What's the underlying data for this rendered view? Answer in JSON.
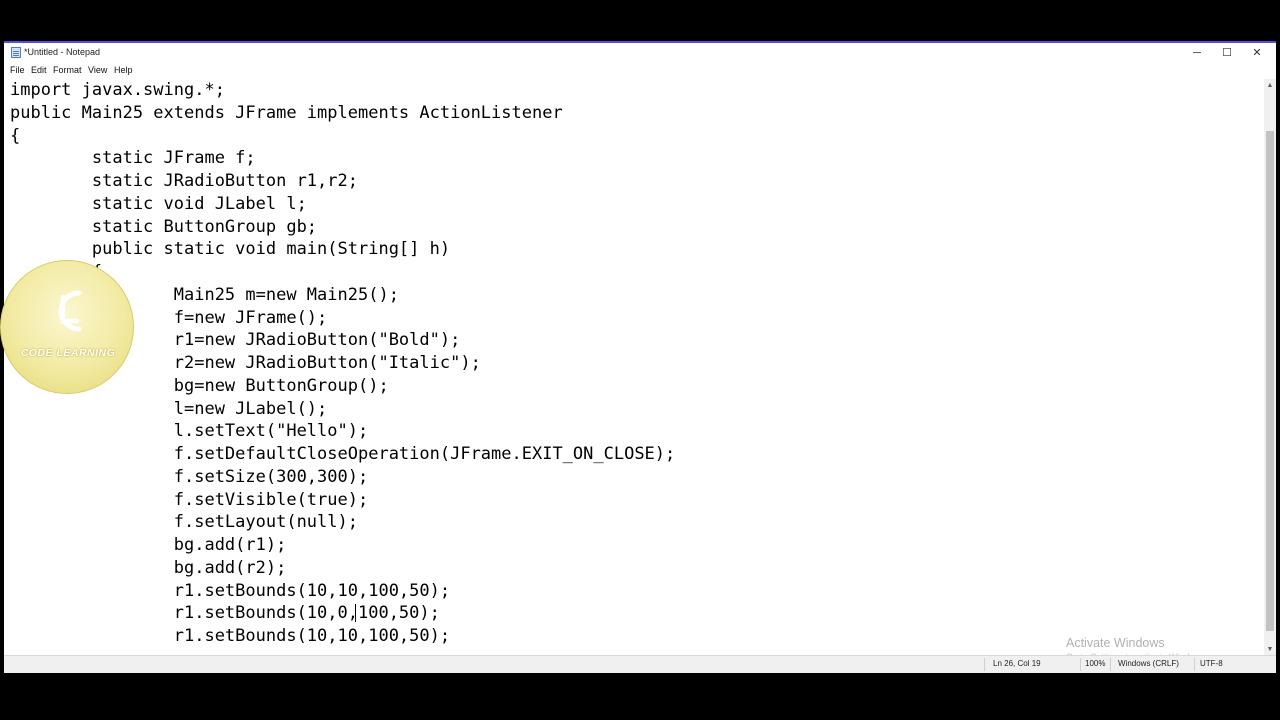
{
  "window": {
    "title": "*Untitled - Notepad",
    "minimize_glyph": "─",
    "maximize_glyph": "☐",
    "close_glyph": "✕",
    "accent": "#5b4ed6"
  },
  "menu": {
    "items": [
      {
        "label": "File"
      },
      {
        "label": "Edit"
      },
      {
        "label": "Format"
      },
      {
        "label": "View"
      },
      {
        "label": "Help"
      }
    ]
  },
  "editor": {
    "lines": [
      "import javax.swing.*;",
      "public Main25 extends JFrame implements ActionListener",
      "{",
      "        static JFrame f;",
      "        static JRadioButton r1,r2;",
      "        static void JLabel l;",
      "        static ButtonGroup gb;",
      "        public static void main(String[] h)",
      "        {",
      "                Main25 m=new Main25();",
      "                f=new JFrame();",
      "                r1=new JRadioButton(\"Bold\");",
      "                r2=new JRadioButton(\"Italic\");",
      "                bg=new ButtonGroup();",
      "                l=new JLabel();",
      "                l.setText(\"Hello\");",
      "                f.setDefaultCloseOperation(JFrame.EXIT_ON_CLOSE);",
      "                f.setSize(300,300);",
      "                f.setVisible(true);",
      "                f.setLayout(null);",
      "                bg.add(r1);",
      "                bg.add(r2);",
      "                r1.setBounds(10,10,100,50);",
      "                r1.setBounds(10,0,100,50);",
      "                r1.setBounds(10,10,100,50);"
    ]
  },
  "status": {
    "position": "Ln 26, Col 19",
    "zoom": "100%",
    "line_ending": "Windows (CRLF)",
    "encoding": "UTF-8"
  },
  "watermark": {
    "title": "Activate Windows",
    "subtitle": "Go to Settings to activate Windows."
  },
  "logo": {
    "text": "CODE LEARNING",
    "color": "#f2eaa2"
  }
}
